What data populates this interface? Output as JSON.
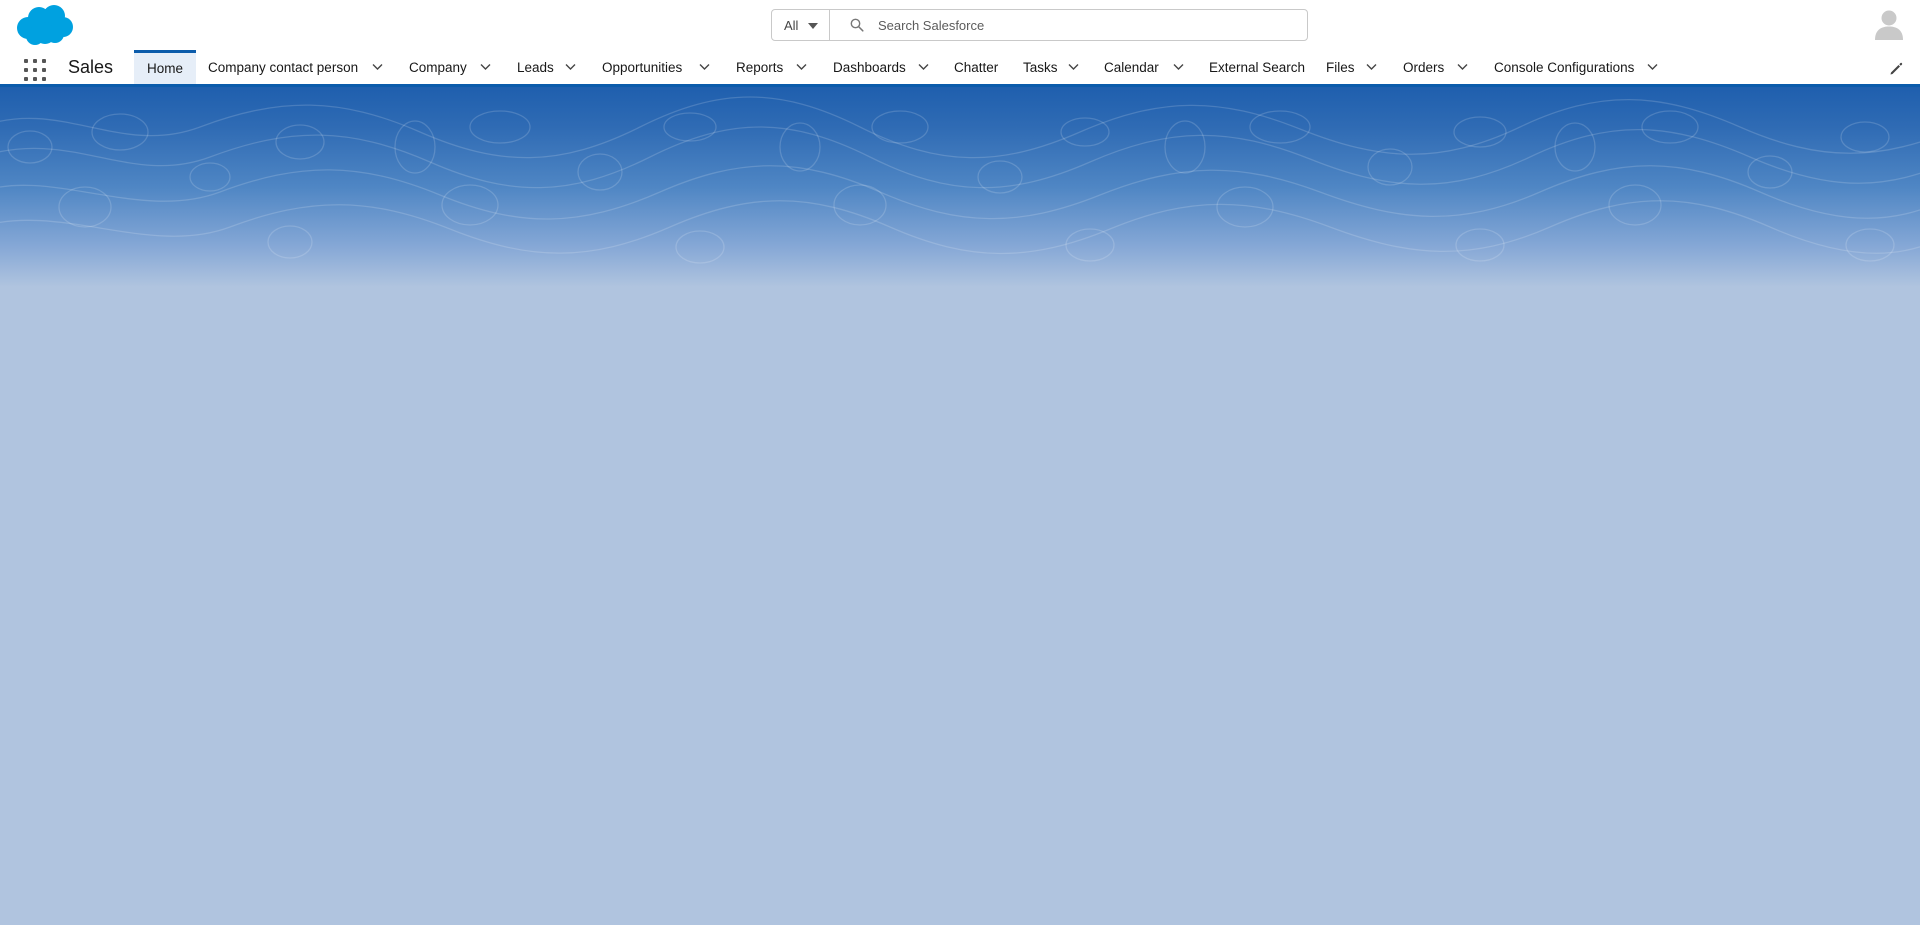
{
  "app": {
    "name": "Sales",
    "brand_icon": "salesforce-cloud-icon",
    "accent_color": "#0b5cab",
    "banner_color": "#1f5fae",
    "background_color": "#b0c4df"
  },
  "search": {
    "scope_label": "All",
    "placeholder": "Search Salesforce",
    "value": ""
  },
  "nav": {
    "items": [
      {
        "label": "Home",
        "active": true,
        "dropdown": false
      },
      {
        "label": "Company contact person",
        "dropdown": true
      },
      {
        "label": "Company",
        "dropdown": true
      },
      {
        "label": "Leads",
        "dropdown": true
      },
      {
        "label": "Opportunities",
        "dropdown": true
      },
      {
        "label": "Reports",
        "dropdown": true
      },
      {
        "label": "Dashboards",
        "dropdown": true
      },
      {
        "label": "Chatter",
        "dropdown": false
      },
      {
        "label": "Tasks",
        "dropdown": true
      },
      {
        "label": "Calendar",
        "dropdown": true
      },
      {
        "label": "External Search",
        "dropdown": false
      },
      {
        "label": "Files",
        "dropdown": true
      },
      {
        "label": "Orders",
        "dropdown": true
      },
      {
        "label": "Console Configurations",
        "dropdown": true
      }
    ]
  }
}
